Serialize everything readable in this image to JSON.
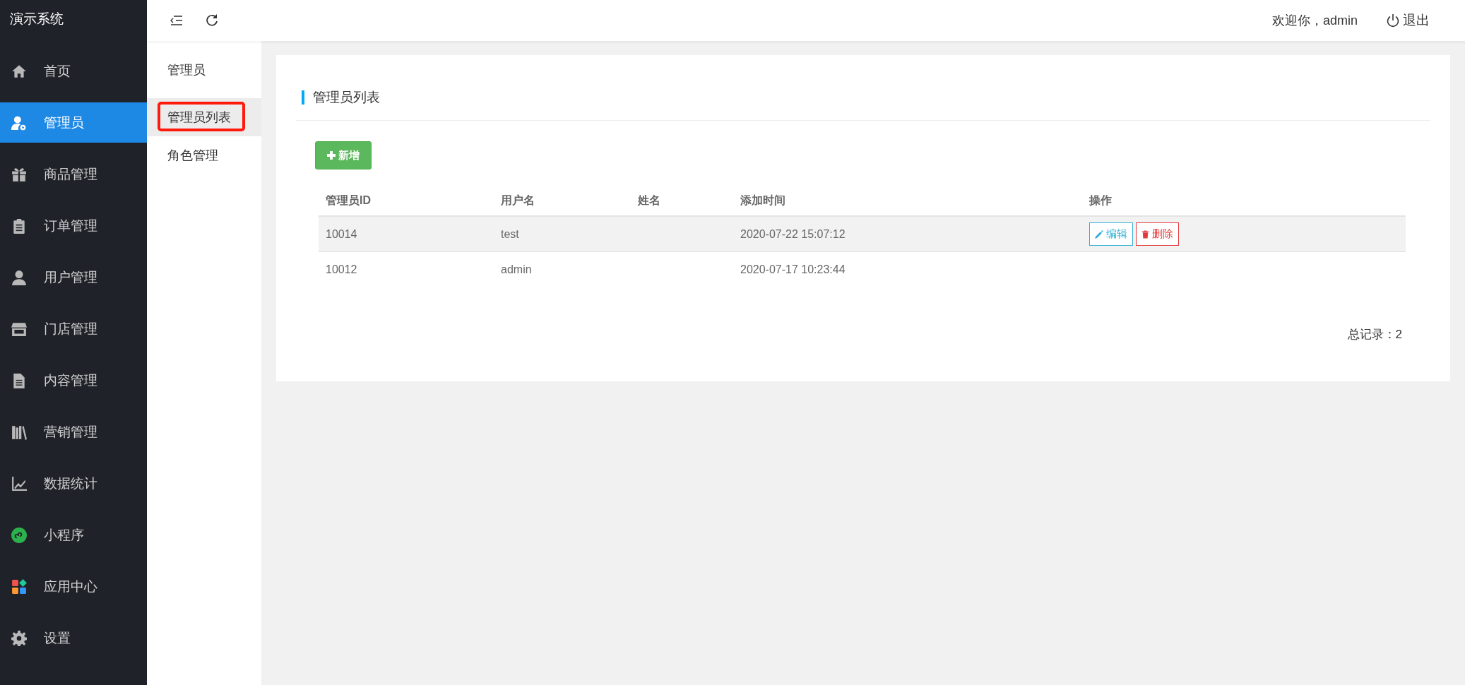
{
  "app_title": "演示系统",
  "sidebar": {
    "items": [
      {
        "label": "首页",
        "selected": false
      },
      {
        "label": "管理员",
        "selected": true
      },
      {
        "label": "商品管理",
        "selected": false
      },
      {
        "label": "订单管理",
        "selected": false
      },
      {
        "label": "用户管理",
        "selected": false
      },
      {
        "label": "门店管理",
        "selected": false
      },
      {
        "label": "内容管理",
        "selected": false
      },
      {
        "label": "营销管理",
        "selected": false
      },
      {
        "label": "数据统计",
        "selected": false
      },
      {
        "label": "小程序",
        "selected": false
      },
      {
        "label": "应用中心",
        "selected": false
      },
      {
        "label": "设置",
        "selected": false
      }
    ]
  },
  "topbar": {
    "welcome": "欢迎你，admin",
    "logout": "退出"
  },
  "submenu": {
    "title": "管理员",
    "items": [
      {
        "label": "管理员列表",
        "selected": true,
        "annotated": true
      },
      {
        "label": "角色管理",
        "selected": false,
        "annotated": false
      }
    ]
  },
  "card": {
    "title": "管理员列表",
    "add_button": "新增",
    "table": {
      "columns": [
        "管理员ID",
        "用户名",
        "姓名",
        "添加时间",
        "操作"
      ],
      "rows": [
        {
          "cells": [
            "10014",
            "test",
            "",
            "2020-07-22 15:07:12"
          ],
          "actions": [
            "编辑",
            "删除"
          ],
          "selected": true
        },
        {
          "cells": [
            "10012",
            "admin",
            "",
            "2020-07-17 10:23:44"
          ],
          "actions": [],
          "selected": false
        }
      ]
    },
    "total": "总记录：2"
  }
}
